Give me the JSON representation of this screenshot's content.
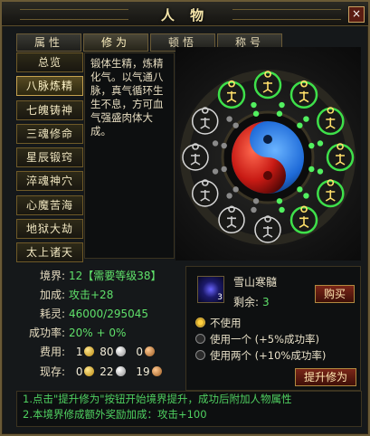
{
  "window": {
    "title": "人 物",
    "close_label": "×"
  },
  "tabs": [
    {
      "label": "属性",
      "active": false
    },
    {
      "label": "修为",
      "active": true
    },
    {
      "label": "顿悟",
      "active": false
    },
    {
      "label": "称号",
      "active": false
    }
  ],
  "nav": {
    "items": [
      "总览",
      "八脉炼精",
      "七魄铸神",
      "三魂修命",
      "星辰锻窍",
      "淬魂神穴",
      "心魔苦海",
      "地狱大劫",
      "太上诸天"
    ],
    "selected_index": 1
  },
  "description": "锻体生精，炼精化气。以气通八脉，真气循环生生不息，方可血气强盛肉体大成。",
  "info": {
    "realm_label": "境界:",
    "realm_value": "12【需要等级38】",
    "bonus_label": "加成:",
    "bonus_value": "攻击+28",
    "spirit_label": "耗灵:",
    "spirit_value": "46000/295045",
    "rate_label": "成功率:",
    "rate_value": "20% + 0%",
    "cost_label": "费用:",
    "cost": [
      "1",
      "80",
      "0"
    ],
    "stock_label": "现存:",
    "stock": [
      "0",
      "22",
      "19"
    ]
  },
  "item": {
    "name": "雪山寒髓",
    "remain_label": "剩余:",
    "remain_value": "3",
    "icon_count": "3",
    "buy_label": "购买"
  },
  "options": [
    {
      "label": "不使用",
      "selected": true
    },
    {
      "label": "使用一个 (+5%成功率)",
      "selected": false
    },
    {
      "label": "使用两个 (+10%成功率)",
      "selected": false
    }
  ],
  "upgrade_label": "提升修为",
  "tips": [
    "1.点击\"提升修为\"按钮开始境界提升，成功后附加人物属性",
    "2.本境界修成额外奖励加成：攻击+100"
  ],
  "colors": {
    "accent_green": "#4fd060",
    "gold_frame": "#6a5a36",
    "button_red": "#7a2618",
    "yin_blue": "#1e6ad8",
    "yang_red": "#c81a14"
  },
  "wheel": {
    "icons": "meridian-figure-icon",
    "nodes_lit": 7,
    "nodes_total": 12
  }
}
